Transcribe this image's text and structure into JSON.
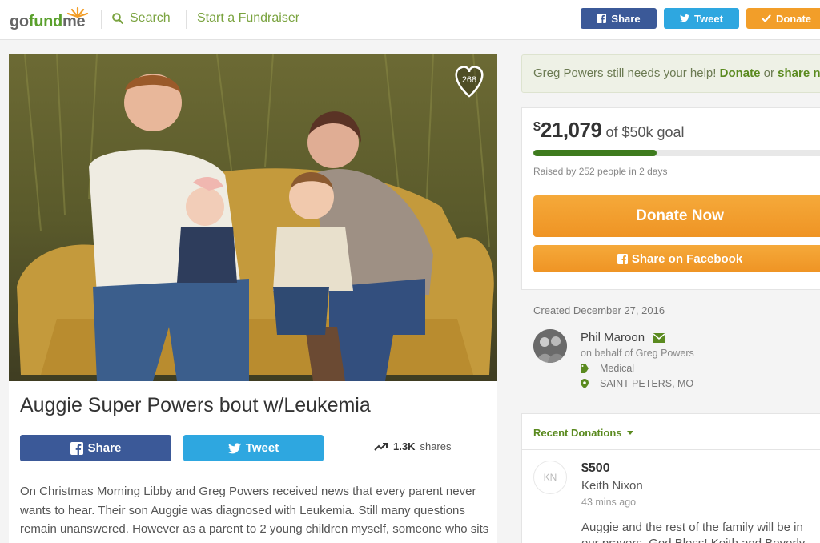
{
  "header": {
    "logo_go": "go",
    "logo_fund": "fund",
    "logo_me": "me",
    "search_label": "Search",
    "start_label": "Start a Fundraiser",
    "share_label": "Share",
    "tweet_label": "Tweet",
    "donate_label": "Donate"
  },
  "photo": {
    "likes": "268"
  },
  "campaign": {
    "title": "Auggie Super Powers bout w/Leukemia",
    "share_label": "Share",
    "tweet_label": "Tweet",
    "shares_count": "1.3K",
    "shares_label": "shares",
    "story": "On Christmas Morning Libby and Greg Powers received news that every parent never wants to hear. Their son Auggie was diagnosed with Leukemia. Still many questions remain unanswered. However as a parent to 2 young children myself, someone who sits next to Greg at work, and cares to pieces about my kid all the time this was a well... it"
  },
  "notice": {
    "prefix": "Greg Powers still needs your help!",
    "donate": "Donate",
    "or": "or",
    "share": "share now"
  },
  "donation": {
    "currency": "$",
    "amount": "21,079",
    "goal": "of $50k goal",
    "progress_fraction": 0.42,
    "raised_by": "Raised by 252 people in 2 days",
    "donate_now": "Donate Now",
    "share_facebook": "Share on Facebook"
  },
  "organizer": {
    "created": "Created December 27, 2016",
    "name": "Phil Maroon",
    "behalf": "on behalf of Greg Powers",
    "category": "Medical",
    "location": "SAINT PETERS, MO"
  },
  "recent": {
    "header": "Recent Donations",
    "donations": [
      {
        "initials": "KN",
        "amount": "$500",
        "name": "Keith Nixon",
        "time": "43 mins ago",
        "message": "Auggie and the rest of the family will be in our prayers. God Bless! Keith and Beverly Nixon"
      }
    ]
  },
  "colors": {
    "brand_green": "#5a8a1f",
    "facebook": "#3b5998",
    "twitter": "#2ea7e0",
    "donate_orange": "#f29e29",
    "progress": "#3e7b1e"
  }
}
